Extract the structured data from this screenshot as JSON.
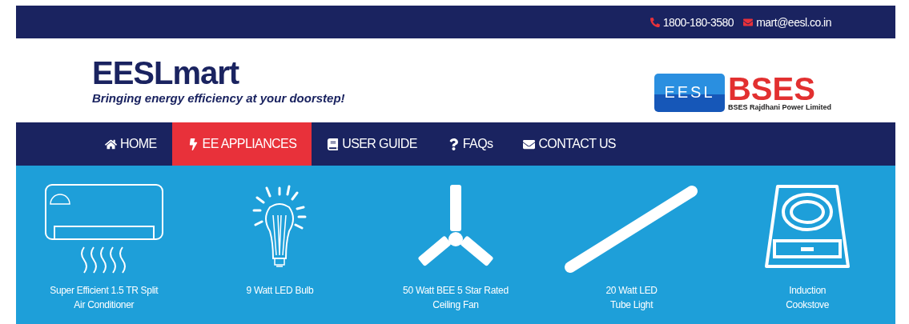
{
  "top_bar": {
    "phone": "1800-180-3580",
    "email": "mart@eesl.co.in"
  },
  "brand": {
    "name": "EESLmart",
    "tagline": "Bringing energy efficiency at your doorstep!"
  },
  "partner_logos": [
    {
      "kind": "eesl",
      "text": "EESL"
    },
    {
      "kind": "bses",
      "text": "BSES",
      "subtext": "BSES Rajdhani Power Limited"
    }
  ],
  "nav": [
    {
      "kind": "home",
      "label": "HOME",
      "selected": false
    },
    {
      "kind": "bolt",
      "label": "EE APPLIANCES",
      "selected": true
    },
    {
      "kind": "book",
      "label": "USER GUIDE",
      "selected": false
    },
    {
      "kind": "question",
      "label": "FAQs",
      "selected": false
    },
    {
      "kind": "envelope",
      "label": "CONTACT US",
      "selected": false
    }
  ],
  "products": [
    {
      "kind": "ac",
      "name": "Super Efficient 1.5 TR Split\nAir Conditioner"
    },
    {
      "kind": "bulb",
      "name": "9 Watt LED Bulb"
    },
    {
      "kind": "fan",
      "name": "50 Watt BEE 5 Star Rated\nCeiling Fan"
    },
    {
      "kind": "tube",
      "name": "20 Watt LED\nTube Light"
    },
    {
      "kind": "cooktop",
      "name": "Induction\nCookstove"
    }
  ]
}
